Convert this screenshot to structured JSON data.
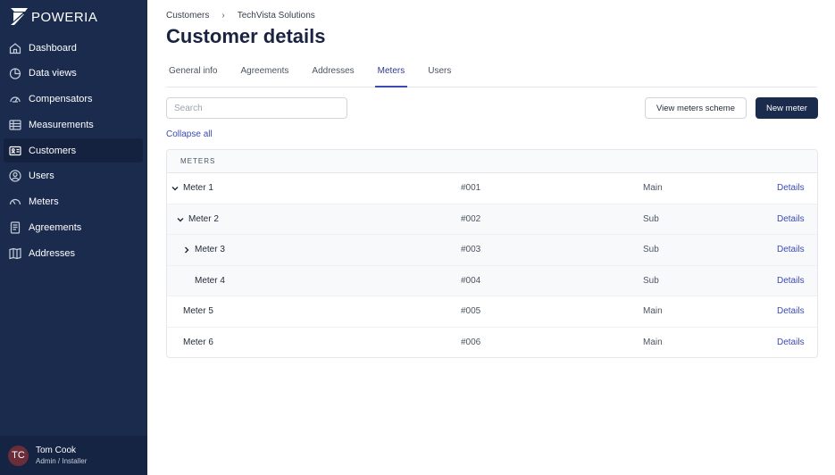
{
  "brand": {
    "name": "POWERIA"
  },
  "sidebar": {
    "items": [
      {
        "label": "Dashboard",
        "icon": "home-icon"
      },
      {
        "label": "Data views",
        "icon": "pie-chart-icon"
      },
      {
        "label": "Compensators",
        "icon": "gauge-icon"
      },
      {
        "label": "Measurements",
        "icon": "table-icon"
      },
      {
        "label": "Customers",
        "icon": "id-card-icon",
        "active": true
      },
      {
        "label": "Users",
        "icon": "user-icon"
      },
      {
        "label": "Meters",
        "icon": "speedometer-icon"
      },
      {
        "label": "Agreements",
        "icon": "document-icon"
      },
      {
        "label": "Addresses",
        "icon": "map-icon"
      }
    ]
  },
  "user": {
    "initials": "TC",
    "name": "Tom Cook",
    "role": "Admin / Installer"
  },
  "breadcrumb": {
    "first": "Customers",
    "second": "TechVista Solutions"
  },
  "page": {
    "title": "Customer details"
  },
  "tabs": [
    {
      "label": "General info"
    },
    {
      "label": "Agreements"
    },
    {
      "label": "Addresses"
    },
    {
      "label": "Meters",
      "active": true
    },
    {
      "label": "Users"
    }
  ],
  "search": {
    "placeholder": "Search"
  },
  "toolbar": {
    "scheme_label": "View meters scheme",
    "new_label": "New meter"
  },
  "collapse_label": "Collapse all",
  "table": {
    "header": "METERS",
    "rows": [
      {
        "name": "Meter 1",
        "code": "#001",
        "type": "Main",
        "action": "Details"
      },
      {
        "name": "Meter 2",
        "code": "#002",
        "type": "Sub",
        "action": "Details"
      },
      {
        "name": "Meter 3",
        "code": "#003",
        "type": "Sub",
        "action": "Details"
      },
      {
        "name": "Meter 4",
        "code": "#004",
        "type": "Sub",
        "action": "Details"
      },
      {
        "name": "Meter 5",
        "code": "#005",
        "type": "Main",
        "action": "Details"
      },
      {
        "name": "Meter 6",
        "code": "#006",
        "type": "Main",
        "action": "Details"
      }
    ]
  },
  "colors": {
    "sidebar": "#1a2b4e",
    "accent": "#3b4bb5",
    "avatar": "#6b2d3a"
  }
}
